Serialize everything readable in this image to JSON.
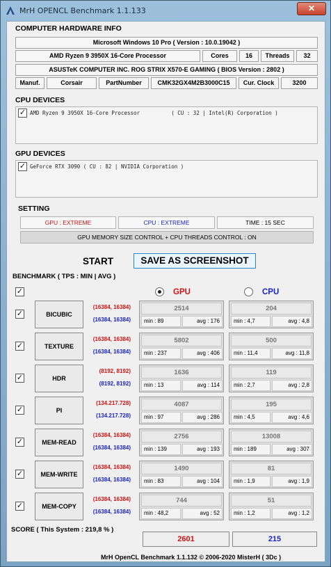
{
  "window": {
    "title": "MrH OPENCL Benchmark 1.1.133",
    "close_glyph": "✕"
  },
  "hardware": {
    "heading": "COMPUTER HARDWARE INFO",
    "os": "Microsoft Windows 10 Pro ( Version : 10.0.19042 )",
    "cpu_name": "AMD Ryzen 9 3950X 16-Core Processor",
    "cores_label": "Cores",
    "cores": "16",
    "threads_label": "Threads",
    "threads": "32",
    "board": "ASUSTeK COMPUTER INC. ROG STRIX X570-E GAMING ( BIOS Version : 2802 )",
    "manuf_label": "Manuf.",
    "manuf": "Corsair",
    "part_label": "PartNumber",
    "part": "CMK32GX4M2B3000C15",
    "clock_label": "Cur. Clock",
    "clock": "3200"
  },
  "cpu_devices": {
    "heading": "CPU DEVICES",
    "item": "AMD Ryzen 9 3950X 16-Core Processor          ( CU : 32 | Intel(R) Corporation )",
    "checked": true
  },
  "gpu_devices": {
    "heading": "GPU DEVICES",
    "item": "GeForce RTX 3090 ( CU : 82 | NVIDIA Corporation )",
    "checked": true
  },
  "setting": {
    "heading": "SETTING",
    "gpu": "GPU : EXTREME",
    "cpu": "CPU : EXTREME",
    "time": "TIME : 15 SEC",
    "control": "GPU MEMORY SIZE CONTROL + CPU THREADS CONTROL : ON"
  },
  "buttons": {
    "start": "START",
    "save": "SAVE AS SCREENSHOT"
  },
  "benchmark": {
    "heading": "BENCHMARK ( TPS : MIN | AVG )",
    "gpu_label": "GPU",
    "cpu_label": "CPU",
    "selected": "GPU",
    "rows": [
      {
        "name": "BICUBIC",
        "size_gpu": "(16384, 16384)",
        "size_cpu": "(16384, 16384)",
        "gpu_val": "2514",
        "gpu_min": "min : 89",
        "gpu_avg": "avg : 176",
        "cpu_val": "204",
        "cpu_min": "min : 4,7",
        "cpu_avg": "avg : 4,8"
      },
      {
        "name": "TEXTURE",
        "size_gpu": "(16384, 16384)",
        "size_cpu": "(16384, 16384)",
        "gpu_val": "5802",
        "gpu_min": "min : 237",
        "gpu_avg": "avg : 406",
        "cpu_val": "500",
        "cpu_min": "min : 11,4",
        "cpu_avg": "avg : 11,8"
      },
      {
        "name": "HDR",
        "size_gpu": "(8192, 8192)",
        "size_cpu": "(8192, 8192)",
        "gpu_val": "1636",
        "gpu_min": "min : 13",
        "gpu_avg": "avg : 114",
        "cpu_val": "119",
        "cpu_min": "min : 2,7",
        "cpu_avg": "avg : 2,8"
      },
      {
        "name": "PI",
        "size_gpu": "(134.217.728)",
        "size_cpu": "(134.217.728)",
        "gpu_val": "4087",
        "gpu_min": "min : 97",
        "gpu_avg": "avg : 286",
        "cpu_val": "195",
        "cpu_min": "min : 4,5",
        "cpu_avg": "avg : 4,6"
      },
      {
        "name": "MEM-READ",
        "size_gpu": "(16384, 16384)",
        "size_cpu": "(16384, 16384)",
        "gpu_val": "2756",
        "gpu_min": "min : 139",
        "gpu_avg": "avg : 193",
        "cpu_val": "13008",
        "cpu_min": "min : 189",
        "cpu_avg": "avg : 307"
      },
      {
        "name": "MEM-WRITE",
        "size_gpu": "(16384, 16384)",
        "size_cpu": "(16384, 16384)",
        "gpu_val": "1490",
        "gpu_min": "min : 83",
        "gpu_avg": "avg : 104",
        "cpu_val": "81",
        "cpu_min": "min : 1,9",
        "cpu_avg": "avg : 1,9"
      },
      {
        "name": "MEM-COPY",
        "size_gpu": "(16384, 16384)",
        "size_cpu": "(16384, 16384)",
        "gpu_val": "744",
        "gpu_min": "min : 48,2",
        "gpu_avg": "avg : 52",
        "cpu_val": "51",
        "cpu_min": "min : 1,2",
        "cpu_avg": "avg : 1,2"
      }
    ]
  },
  "score": {
    "label": "SCORE ( This System : 219,8 % )",
    "gpu": "2601",
    "cpu": "215"
  },
  "footer": "MrH OpenCL Benchmark 1.1.132  ©  2006-2020 MisterH ( 3Dc )",
  "colors": {
    "gpu_red": "#d11313",
    "cpu_blue": "#1a23c4"
  }
}
